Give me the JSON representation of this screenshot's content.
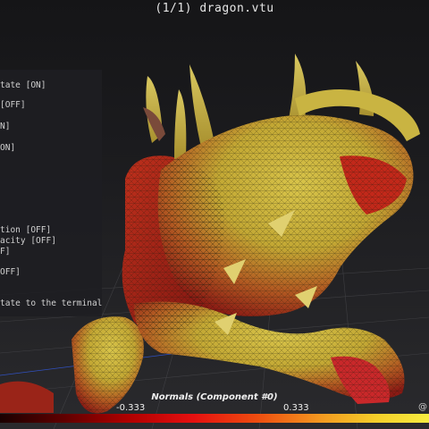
{
  "window": {
    "title": "(1/1) dragon.vtu"
  },
  "help_panel": {
    "lines": [
      "tate [ON]",
      "[OFF]",
      "N]",
      "ON]",
      "tion [OFF]",
      "acity [OFF]",
      "F]",
      "OFF]",
      "tate to the terminal"
    ]
  },
  "colorbar": {
    "title": "Normals (Component #0)",
    "min_label": "-0.333",
    "max_label": "0.333"
  },
  "watermark": {
    "text": "@"
  },
  "colors": {
    "background": "#1c1c1f",
    "mesh_yellow": "#c8b43a",
    "mesh_red": "#b8281a",
    "grid": "#555555"
  }
}
